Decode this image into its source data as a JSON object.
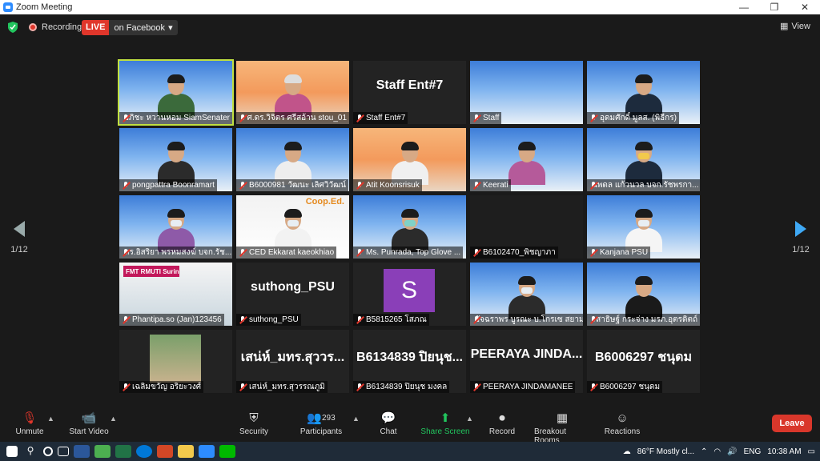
{
  "window": {
    "title": "Zoom Meeting",
    "min": "—",
    "max": "❐",
    "close": "✕"
  },
  "topbar": {
    "recording": "Recording",
    "live": "LIVE",
    "live_target": "on Facebook",
    "view": "View"
  },
  "nav": {
    "left_page": "1/12",
    "right_page": "1/12"
  },
  "tiles": [
    {
      "name": "อภิชะ หวานหอม SiamSenater"
    },
    {
      "name": "ศ.ดร.วิจิตร ศรีสอ้าน stou_01"
    },
    {
      "name": "Staff Ent#7",
      "big": "Staff Ent#7"
    },
    {
      "name": "Staff"
    },
    {
      "name": "อุดมศักดิ์ มูลส. (พิธีกร)"
    },
    {
      "name": "pongpattra Boonramart"
    },
    {
      "name": "B6000981 วัฒนะ เลิศวิวัฒน์"
    },
    {
      "name": "Atit Koonsrisuk"
    },
    {
      "name": "Keerati"
    },
    {
      "name": "นพดล แก้วนวล บจก.รัชพรกา..."
    },
    {
      "name": "ดร.อิสริยา พรหมสงฆ์ บจก.รัช..."
    },
    {
      "name": "CED Ekkarat kaeokhiao",
      "logo": "Coop.Ed."
    },
    {
      "name": "Ms. Punrada, Top Glove ..."
    },
    {
      "name": "B6102470_พิชญาภา"
    },
    {
      "name": "Kanjana PSU"
    },
    {
      "name": "Phantipa.so (Jan)123456",
      "logo": "FMT RMUTI Surin"
    },
    {
      "name": "suthong_PSU",
      "big": "suthong_PSU"
    },
    {
      "name": "B5815265 โสภณ",
      "avatar": "S"
    },
    {
      "name": "อัจฉราพร บูรณะ บ.โกรเซ สยาม"
    },
    {
      "name": "สาธิษฐ์ กระจ่าง มรภ.อุตรดิตถ์"
    },
    {
      "name": "เฉลิมขวัญ อริยะวงศ์"
    },
    {
      "name": "เสน่ห์_มทร.สุวรรณภูมิ",
      "big": "เสน่ห์_มทร.สุววร..."
    },
    {
      "name": "B6134839 ปิยนุช มงคล",
      "big": "B6134839 ปิยนุช..."
    },
    {
      "name": "PEERAYA JINDAMANEE",
      "big": "PEERAYA JINDA..."
    },
    {
      "name": "B6006297 ชนุดม",
      "big": "B6006297 ชนุดม"
    }
  ],
  "toolbar": {
    "unmute": "Unmute",
    "start_video": "Start Video",
    "security": "Security",
    "participants": "Participants",
    "participants_count": "293",
    "chat": "Chat",
    "share": "Share Screen",
    "record": "Record",
    "breakout": "Breakout Rooms",
    "reactions": "Reactions",
    "leave": "Leave"
  },
  "taskbar": {
    "weather": "86°F  Mostly cl...",
    "lang": "ENG",
    "time": "10:38 AM"
  }
}
